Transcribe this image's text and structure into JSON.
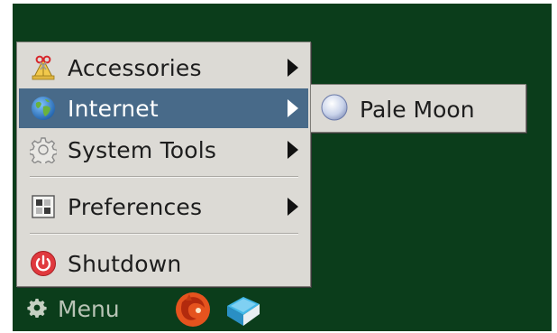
{
  "menu": {
    "items": [
      {
        "label": "Accessories",
        "icon": "accessories-icon",
        "has_submenu": true
      },
      {
        "label": "Internet",
        "icon": "globe-icon",
        "has_submenu": true,
        "active": true
      },
      {
        "label": "System Tools",
        "icon": "gear-icon",
        "has_submenu": true
      },
      {
        "label": "Preferences",
        "icon": "preferences-icon",
        "has_submenu": true
      },
      {
        "label": "Shutdown",
        "icon": "power-icon",
        "has_submenu": false
      }
    ]
  },
  "submenu": {
    "items": [
      {
        "label": "Pale Moon",
        "icon": "pale-moon-icon"
      }
    ]
  },
  "taskbar": {
    "menu_label": "Menu",
    "launchers": [
      {
        "icon": "fox-browser-icon"
      },
      {
        "icon": "book-icon"
      }
    ]
  },
  "colors": {
    "desktop": "#0b3d1b",
    "menu_bg": "#dcdad5",
    "highlight": "#486a89"
  }
}
